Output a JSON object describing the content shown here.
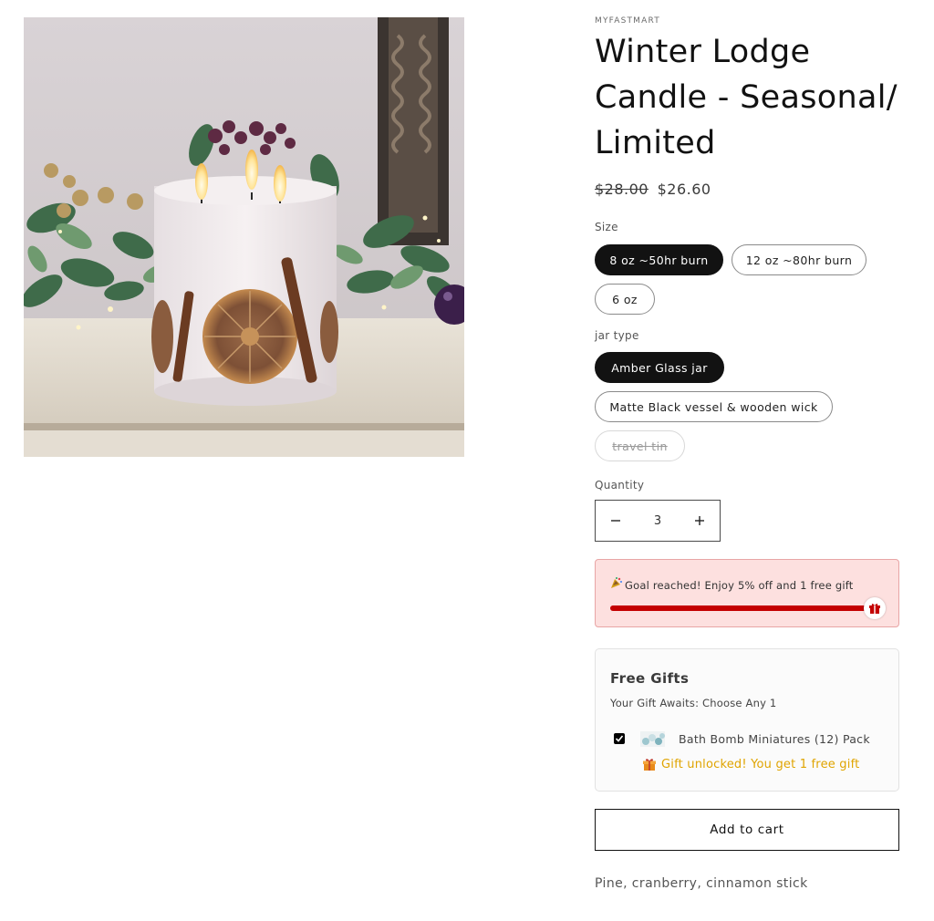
{
  "product": {
    "vendor": "MYFASTMART",
    "title": "Winter Lodge Candle - Seasonal/ Limited",
    "price_compare": "$28.00",
    "price_sale": "$26.60",
    "description": "Pine, cranberry, cinnamon stick",
    "image_icon": "candle-product-photo"
  },
  "options": {
    "size": {
      "label": "Size",
      "values": [
        "8 oz ~50hr burn",
        "12 oz ~80hr burn",
        "6 oz"
      ],
      "selected": "8 oz ~50hr burn"
    },
    "jar": {
      "label": "jar type",
      "values": [
        "Amber Glass jar",
        "Matte Black vessel & wooden wick",
        "travel tin"
      ],
      "selected": "Amber Glass jar",
      "unavailable": [
        "travel tin"
      ]
    }
  },
  "quantity": {
    "label": "Quantity",
    "value": "3",
    "minus_icon": "minus-icon",
    "plus_icon": "plus-icon"
  },
  "goal_bar": {
    "message": "Goal reached! Enjoy 5% off and 1 free gift",
    "progress": 1.0,
    "icon": "party-popper-icon",
    "end_icon": "gift-icon",
    "colors": {
      "background": "#fde0df",
      "fill": "#c40000"
    }
  },
  "free_gifts": {
    "heading": "Free Gifts",
    "subheading": "Your Gift Awaits: Choose Any 1",
    "items": [
      {
        "name": "Bath Bomb Miniatures (12) Pack",
        "checked": true
      }
    ],
    "unlocked_message": "Gift unlocked! You get 1 free gift",
    "unlocked_color": "#e0a400"
  },
  "cart": {
    "add_label": "Add to cart"
  }
}
